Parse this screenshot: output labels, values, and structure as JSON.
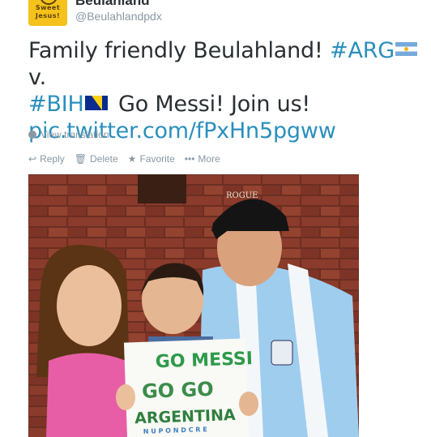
{
  "author": {
    "name": "Beulahland",
    "handle": "@Beulahlandpdx",
    "avatar_text_line1": "Sweet",
    "avatar_text_line2": "Jesus!"
  },
  "tweet": {
    "part1": "Family friendly Beulahland! ",
    "hashtag_arg": "#ARG",
    "part2": " v.",
    "hashtag_bih": "#BIH",
    "part3": " Go Messi! Join us!",
    "link": "pic.twitter.com/fPxHn5pgww"
  },
  "translate_label": "View translation",
  "actions": {
    "reply": "Reply",
    "delete": "Delete",
    "favorite": "Favorite",
    "more": "More"
  },
  "photo": {
    "cap_text": "ROGUE",
    "sign_line1": "GO MESSI",
    "sign_line2": "GO GO",
    "sign_line3": "ARGENTINA",
    "sign_line4": "N U P O N D C R E"
  },
  "colors": {
    "link": "#2a8fbd",
    "text": "#292f33",
    "muted": "#8899a6"
  }
}
